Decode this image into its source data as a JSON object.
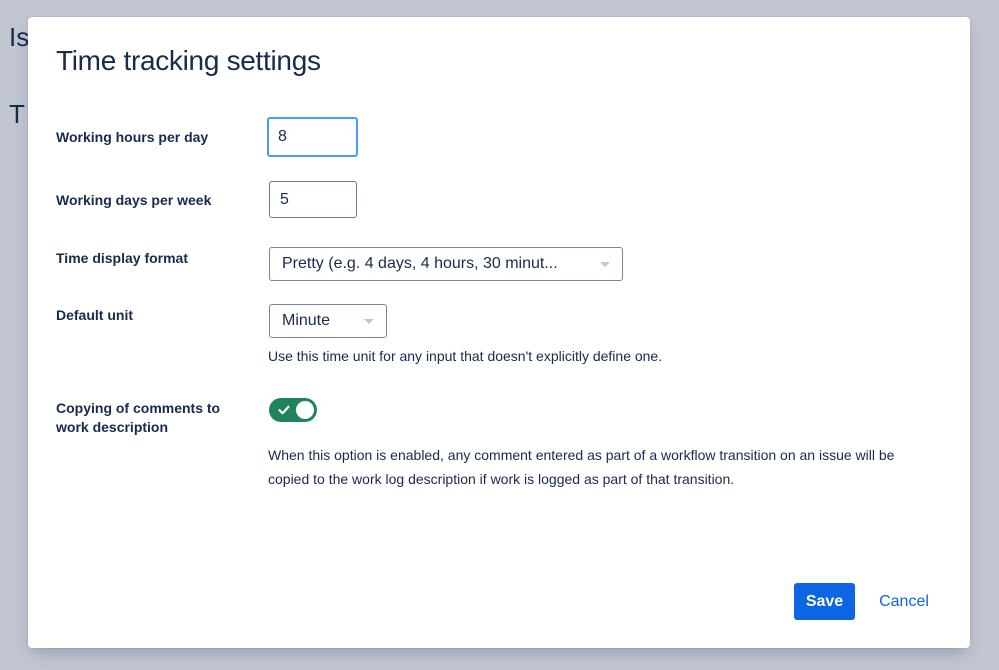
{
  "background": {
    "heading_1": "Is",
    "heading_2": "T"
  },
  "dialog": {
    "title": "Time tracking settings",
    "fields": {
      "hours_per_day": {
        "label": "Working hours per day",
        "value": "8"
      },
      "days_per_week": {
        "label": "Working days per week",
        "value": "5"
      },
      "display_format": {
        "label": "Time display format",
        "selected": "Pretty (e.g. 4 days, 4 hours, 30 minut..."
      },
      "default_unit": {
        "label": "Default unit",
        "selected": "Minute",
        "help": "Use this time unit for any input that doesn't explicitly define one."
      },
      "copy_comments": {
        "label_line_1": "Copying of comments to",
        "label_line_2": "work description",
        "enabled": true,
        "help_line_1": "When this option is enabled, any comment entered as part of a workflow transition on an issue will be",
        "help_line_2": "copied to the work log description if work is logged as part of that transition."
      }
    },
    "actions": {
      "save_label": "Save",
      "cancel_label": "Cancel"
    }
  },
  "colors": {
    "primary": "#0c66e4",
    "toggle_on": "#1f845a",
    "focus_ring": "#4c9aff",
    "text": "#172b4d",
    "overlay": "#c2c6d1"
  },
  "icons": {
    "toggle_check": "check-icon",
    "select_caret": "chevron-down-icon"
  }
}
